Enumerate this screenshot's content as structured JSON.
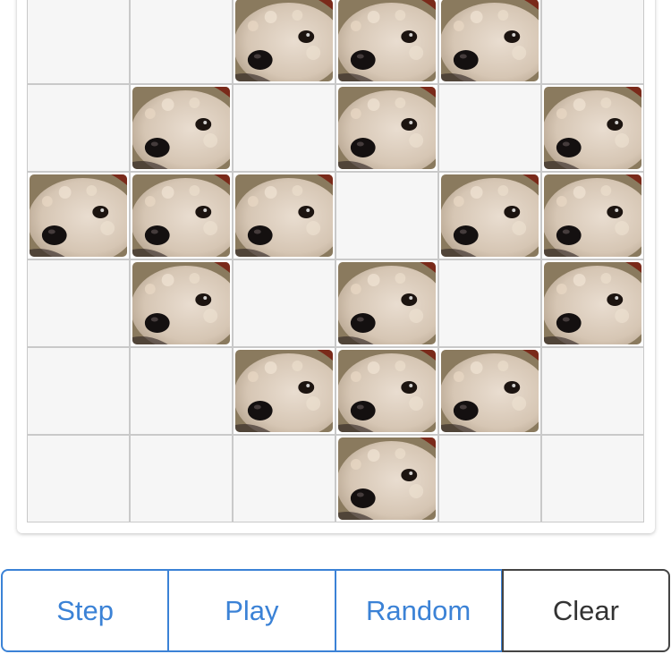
{
  "board": {
    "rows": 6,
    "cols": 6,
    "alive_image": "dog-face-photo",
    "cells": [
      [
        0,
        0,
        1,
        1,
        1,
        0
      ],
      [
        0,
        1,
        0,
        1,
        0,
        1
      ],
      [
        1,
        1,
        1,
        0,
        1,
        1
      ],
      [
        0,
        1,
        0,
        1,
        0,
        1
      ],
      [
        0,
        0,
        1,
        1,
        1,
        0
      ],
      [
        0,
        0,
        0,
        1,
        0,
        0
      ]
    ]
  },
  "controls": {
    "step_label": "Step",
    "play_label": "Play",
    "random_label": "Random",
    "clear_label": "Clear"
  },
  "colors": {
    "primary": "#3b82d6",
    "dark": "#333333",
    "dead_cell": "#f6f6f6",
    "grid_line": "#c9c9c9"
  }
}
